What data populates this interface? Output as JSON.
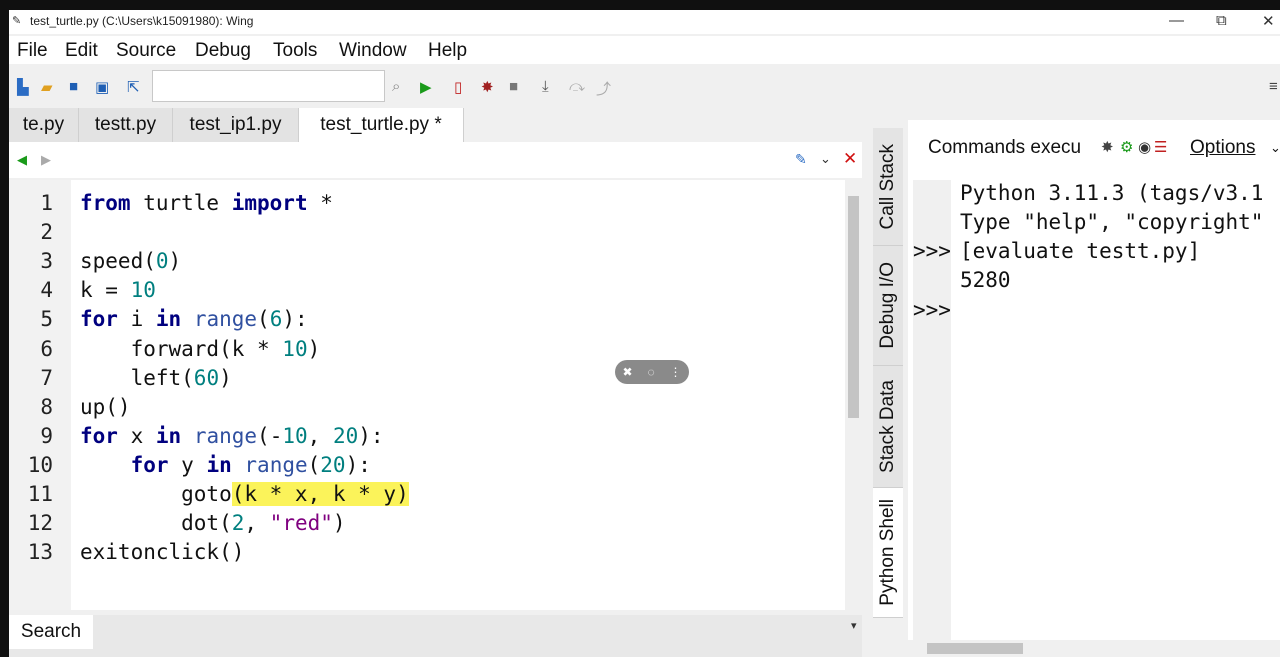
{
  "window": {
    "title": "test_turtle.py (C:\\Users\\k15091980): Wing",
    "controls": [
      "—",
      "⧉",
      "✕"
    ]
  },
  "menu": [
    "File",
    "Edit",
    "Source",
    "Debug",
    "Tools",
    "Window",
    "Help"
  ],
  "toolbar": {
    "search_value": "",
    "icons": [
      "new-file-icon",
      "open-folder-icon",
      "save-icon",
      "save-all-icon",
      "goto-icon",
      "search-icon",
      "run-icon",
      "new-debug-icon",
      "bug-icon",
      "stop-icon",
      "step-into-icon",
      "step-over-icon",
      "step-out-icon"
    ]
  },
  "editor_tabs": [
    {
      "label": "te.py",
      "active": false
    },
    {
      "label": "testt.py",
      "active": false
    },
    {
      "label": "test_ip1.py",
      "active": false
    },
    {
      "label": "test_turtle.py *",
      "active": true
    }
  ],
  "editor": {
    "line_numbers": [
      "1",
      "2",
      "3",
      "4",
      "5",
      "6",
      "7",
      "8",
      "9",
      "10",
      "11",
      "12",
      "13"
    ]
  },
  "bottom": {
    "search_label": "Search"
  },
  "vertical_tabs": [
    {
      "label": "Call Stack",
      "active": false
    },
    {
      "label": "Debug I/O",
      "active": false
    },
    {
      "label": "Stack Data",
      "active": false
    },
    {
      "label": "Python Shell",
      "active": true
    }
  ],
  "shell": {
    "header_label": "Commands execu",
    "options_label": "Options",
    "lines": [
      "Python 3.11.3 (tags/v3.1",
      "Type \"help\", \"copyright\"",
      "[evaluate testt.py]",
      "5280"
    ],
    "prompts": [
      ">>>",
      ">>>"
    ]
  }
}
